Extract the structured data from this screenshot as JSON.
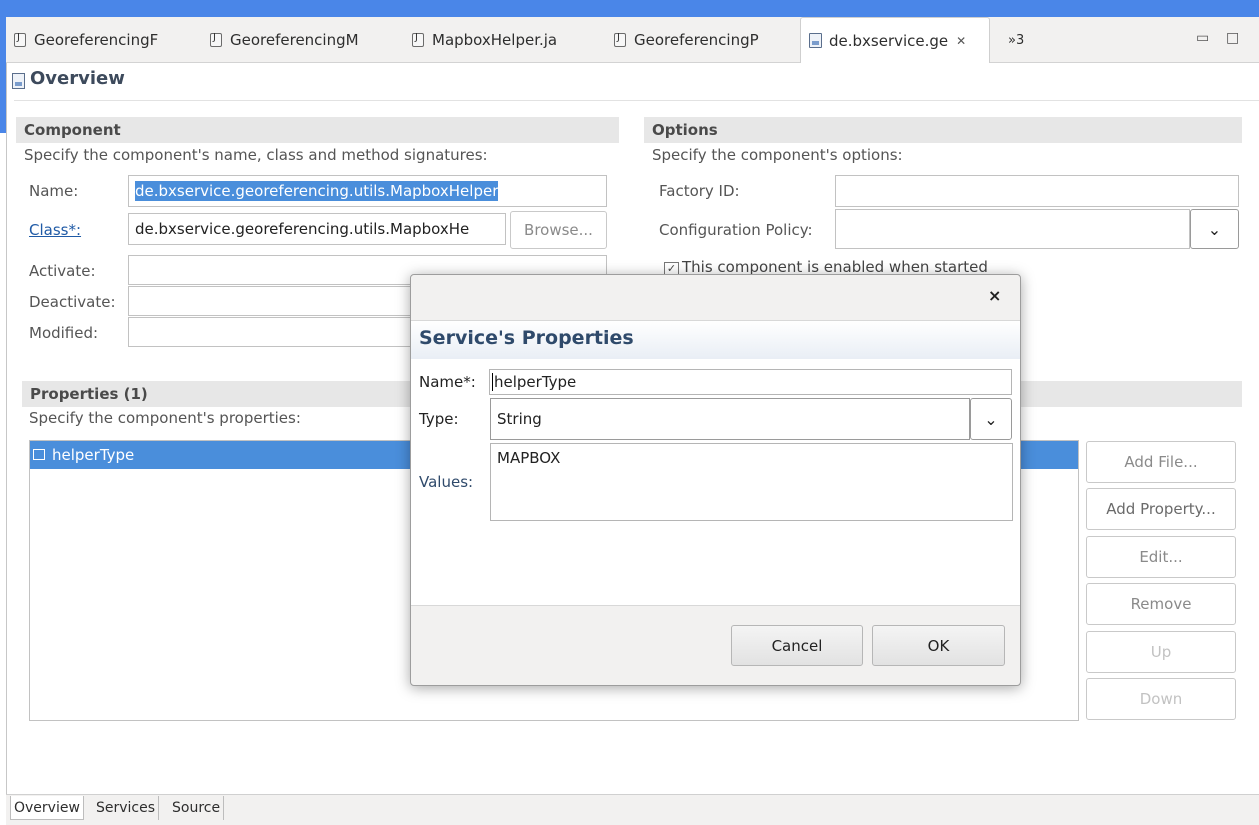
{
  "tabs": [
    {
      "label": "GeoreferencingF"
    },
    {
      "label": "GeoreferencingM"
    },
    {
      "label": "MapboxHelper.ja"
    },
    {
      "label": "GeoreferencingP"
    },
    {
      "label": "de.bxservice.ge"
    }
  ],
  "tab_overflow": "»3",
  "page_title": "Overview",
  "component": {
    "title": "Component",
    "description": "Specify the component's name, class and method signatures:",
    "name_label": "Name:",
    "name_value": "de.bxservice.georeferencing.utils.MapboxHelper",
    "class_label": "Class*:",
    "class_value": "de.bxservice.georeferencing.utils.MapboxHe",
    "browse_label": "Browse...",
    "activate_label": "Activate:",
    "deactivate_label": "Deactivate:",
    "modified_label": "Modified:"
  },
  "options": {
    "title": "Options",
    "description": "Specify the component's options:",
    "factory_label": "Factory ID:",
    "config_label": "Configuration Policy:",
    "enabled_label": "This component is enabled when started"
  },
  "properties": {
    "title": "Properties (1)",
    "description": "Specify the component's properties:",
    "items": [
      {
        "label": "helperType"
      }
    ],
    "buttons": {
      "add_file": "Add File...",
      "add_property": "Add Property...",
      "edit": "Edit...",
      "remove": "Remove",
      "up": "Up",
      "down": "Down"
    }
  },
  "bottom_tabs": [
    "Overview",
    "Services",
    "Source"
  ],
  "dialog": {
    "close_glyph": "×",
    "heading": "Service's Properties",
    "name_label": "Name*:",
    "name_value": "helperType",
    "type_label": "Type:",
    "type_value": "String",
    "values_label": "Values:",
    "values_value": "MAPBOX",
    "cancel_label": "Cancel",
    "ok_label": "OK"
  }
}
